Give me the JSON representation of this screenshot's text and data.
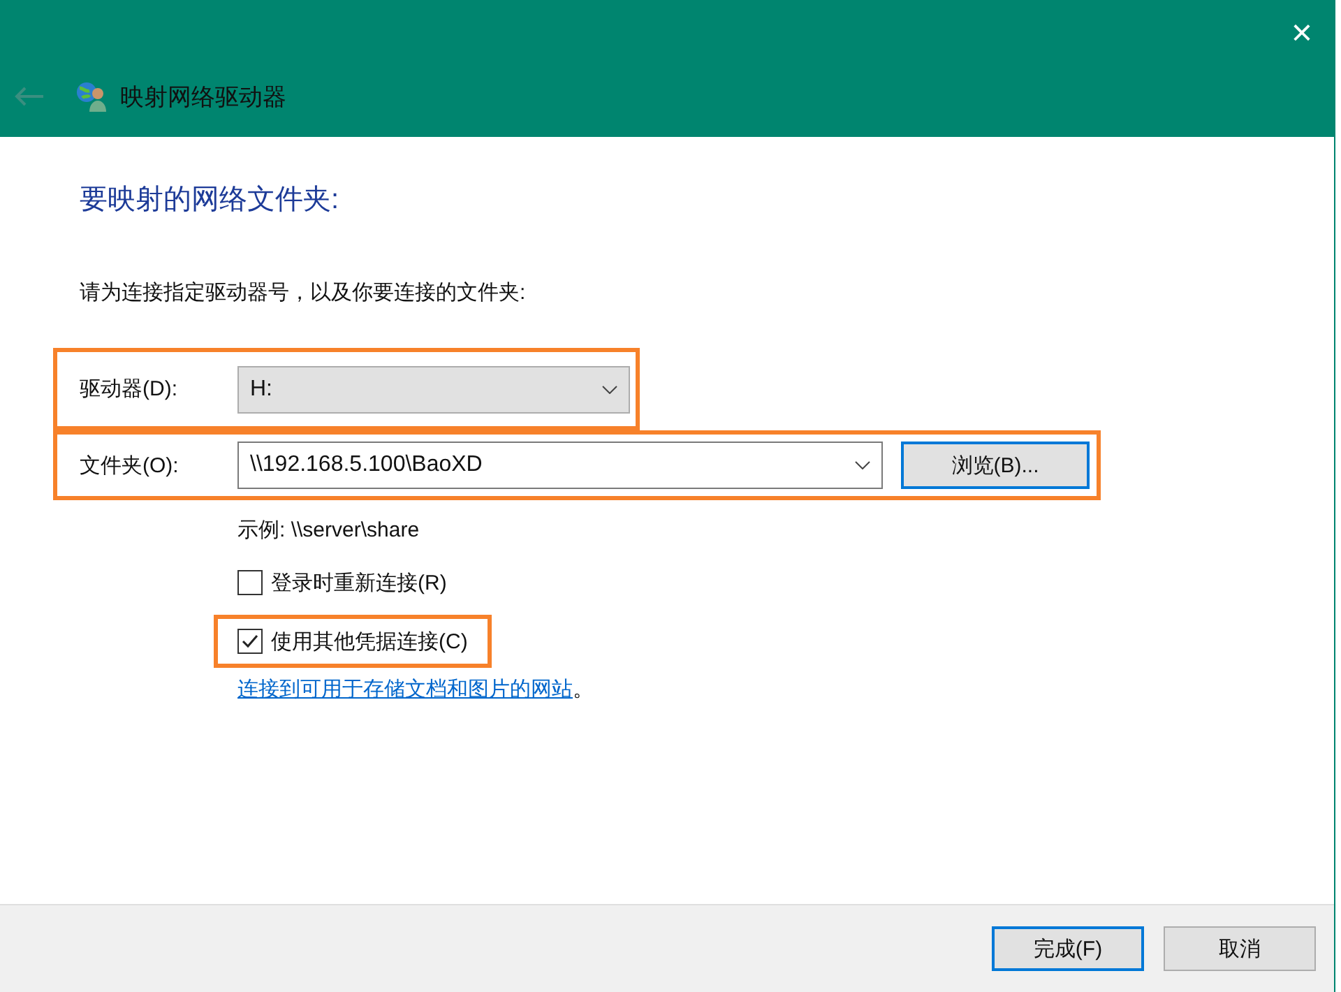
{
  "window": {
    "title": "映射网络驱动器",
    "close": "×"
  },
  "heading": "要映射的网络文件夹:",
  "instruction": "请为连接指定驱动器号，以及你要连接的文件夹:",
  "drive": {
    "label": "驱动器(D):",
    "value": "H:",
    "highlighted": true
  },
  "folder": {
    "label": "文件夹(O):",
    "value": "\\\\192.168.5.100\\BaoXD",
    "highlighted": true,
    "browse": {
      "label": "浏览(B)...",
      "focused": true
    }
  },
  "example": "示例: \\\\server\\share",
  "checkboxes": [
    {
      "label": "登录时重新连接(R)",
      "checked": false,
      "highlighted": false
    },
    {
      "label": "使用其他凭据连接(C)",
      "checked": true,
      "highlighted": true
    }
  ],
  "link": {
    "text": "连接到可用于存储文档和图片的网站",
    "suffix": "。"
  },
  "buttons": [
    {
      "label": "完成(F)",
      "focused": true
    },
    {
      "label": "取消",
      "focused": false
    }
  ]
}
